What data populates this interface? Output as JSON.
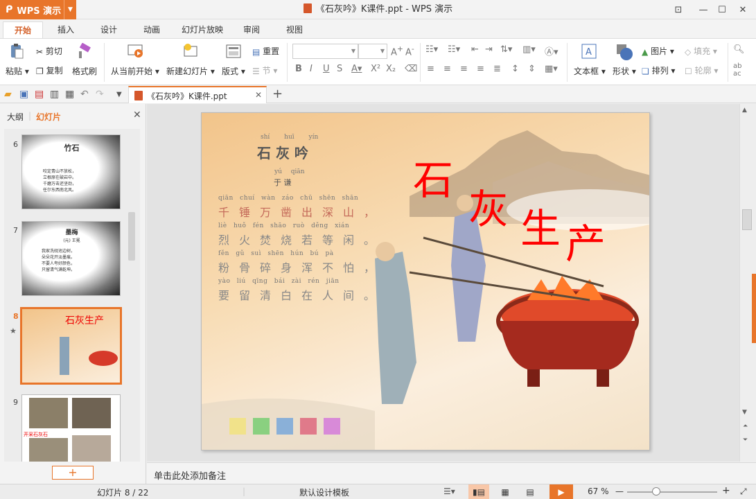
{
  "app": {
    "name": "WPS 演示",
    "logo": "wps-logo-icon"
  },
  "window": {
    "title": "《石灰吟》K课件.ppt - WPS 演示"
  },
  "tabs": [
    {
      "label": "开始",
      "active": true
    },
    {
      "label": "插入"
    },
    {
      "label": "设计"
    },
    {
      "label": "动画"
    },
    {
      "label": "幻灯片放映"
    },
    {
      "label": "审阅"
    },
    {
      "label": "视图"
    }
  ],
  "ribbon": {
    "paste": "粘贴",
    "cut": "剪切",
    "copy": "复制",
    "format_painter": "格式刷",
    "from_current": "从当前开始",
    "new_slide": "新建幻灯片",
    "layout": "版式",
    "reset": "重置",
    "section": "节",
    "textbox": "文本框",
    "shape": "形状",
    "picture": "图片",
    "fill": "填充",
    "arrange": "排列",
    "outline": "轮廓"
  },
  "doc_tab": {
    "label": "《石灰吟》K课件.ppt"
  },
  "left_panel": {
    "tab_outline": "大纲",
    "tab_slides": "幻灯片",
    "thumbnails": [
      {
        "num": "6",
        "title": "竹石",
        "lines": [
          "咬定青山不放松，",
          "立根原在破岩中。",
          "千磨万击还坚劲，",
          "任尔东西南北风。"
        ]
      },
      {
        "num": "7",
        "title": "墨梅",
        "author": "(元) 王冕",
        "lines": [
          "我家洗砚池边树，",
          "朵朵花开淡墨痕。",
          "不要人夸好颜色，",
          "只留清气满乾坤。"
        ]
      },
      {
        "num": "8",
        "caption": "石灰生产",
        "selected": true
      },
      {
        "num": "9",
        "caption": "开采石灰石"
      }
    ]
  },
  "slide": {
    "title": "石 灰 吟",
    "pinyin_title": [
      "shí",
      "huī",
      "yín"
    ],
    "author_pinyin": [
      "yú",
      "qiān"
    ],
    "author": "于 谦",
    "poem_lines": [
      {
        "pinyin": "qiān chuí wàn záo chū shēn shān",
        "text": "千锤万凿出深山，"
      },
      {
        "pinyin": "liè huǒ fén shāo ruò děng xián",
        "text": "烈火焚烧若等闲。"
      },
      {
        "pinyin": "fěn gǔ suì shēn hún bú pà",
        "text": "粉骨碎身浑不怕，"
      },
      {
        "pinyin": "yào liú qīng bái zài rén jiān",
        "text": "要留清白在人间。"
      }
    ],
    "overlay": [
      "石",
      "灰",
      "生",
      "产"
    ]
  },
  "notes_placeholder": "单击此处添加备注",
  "status": {
    "slide_counter": "幻灯片 8 / 22",
    "template": "默认设计模板",
    "zoom": "67 %"
  },
  "colors": {
    "accent": "#e8752a",
    "overlay_text": "#ff0000"
  }
}
